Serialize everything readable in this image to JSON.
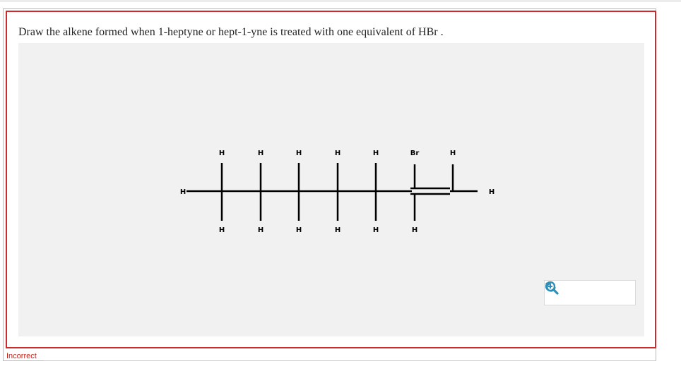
{
  "question": {
    "prompt": "Draw the alkene formed when 1-heptyne or hept-1-yne is treated with one equivalent of HBr ."
  },
  "structure": {
    "left_terminal_h": "H",
    "right_terminal_h": "H",
    "top_substituents": [
      "H",
      "H",
      "H",
      "H",
      "H",
      "Br",
      "H"
    ],
    "bottom_substituents": [
      "H",
      "H",
      "H",
      "H",
      "H",
      "H"
    ],
    "double_bond_between_carbons": [
      6,
      7
    ]
  },
  "toolbar": {
    "zoom_in_icon": "zoom-in-icon",
    "reset_icon": "reset-zoom-icon",
    "zoom_out_icon": "zoom-out-icon",
    "icon_color": "#2d8fb8"
  },
  "feedback": {
    "status": "Incorrect",
    "status_color": "#c0241c"
  },
  "colors": {
    "border_incorrect": "#cc2b2b",
    "canvas_bg": "#f1f1f1"
  }
}
